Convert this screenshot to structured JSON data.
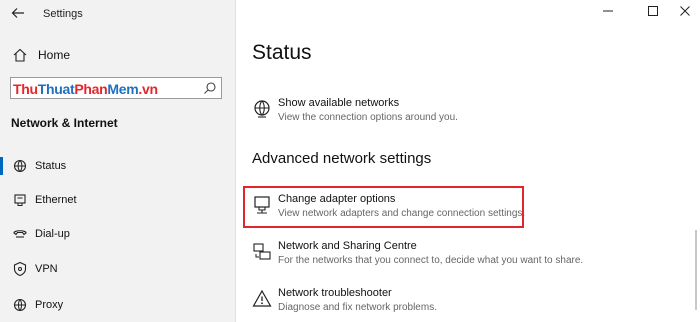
{
  "window": {
    "title": "Settings",
    "minimize_icon": "minimize-icon",
    "maximize_icon": "maximize-icon",
    "close_icon": "close-icon"
  },
  "sidebar": {
    "home_label": "Home",
    "search": {
      "value": "ThuThuatPhanMem.vn",
      "placeholder": ""
    },
    "section_title": "Network & Internet",
    "items": [
      {
        "label": "Status",
        "icon": "status-icon",
        "selected": true
      },
      {
        "label": "Ethernet",
        "icon": "ethernet-icon",
        "selected": false
      },
      {
        "label": "Dial-up",
        "icon": "dial-up-icon",
        "selected": false
      },
      {
        "label": "VPN",
        "icon": "vpn-icon",
        "selected": false
      },
      {
        "label": "Proxy",
        "icon": "proxy-icon",
        "selected": false
      }
    ]
  },
  "main": {
    "title": "Status",
    "show_networks": {
      "title": "Show available networks",
      "desc": "View the connection options around you."
    },
    "advanced_title": "Advanced network settings",
    "adapter": {
      "title": "Change adapter options",
      "desc": "View network adapters and change connection settings."
    },
    "sharing": {
      "title": "Network and Sharing Centre",
      "desc": "For the networks that you connect to, decide what you want to share."
    },
    "troubleshooter": {
      "title": "Network troubleshooter",
      "desc": "Diagnose and fix network problems."
    }
  },
  "colors": {
    "accent": "#0067c0",
    "highlight": "#e0262b",
    "watermark_red": "#e5262b",
    "watermark_blue": "#1f6fc2"
  }
}
